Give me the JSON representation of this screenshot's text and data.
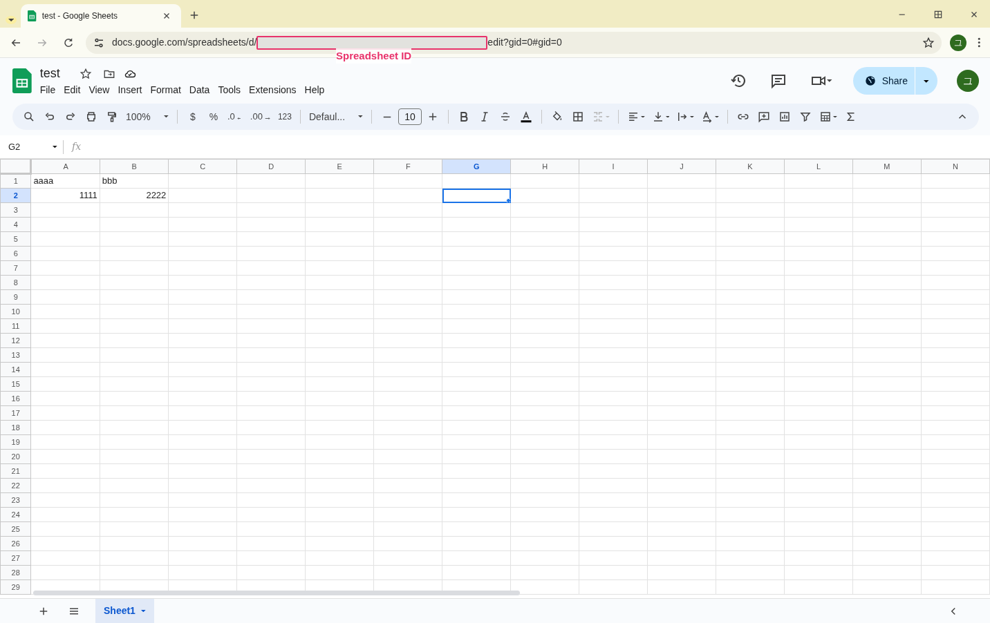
{
  "browser": {
    "tab_title": "test - Google Sheets",
    "url_prefix": "docs.google.com/spreadsheets/d/",
    "url_suffix": "edit?gid=0#gid=0",
    "annotation": "Spreadsheet ID",
    "profile_initial": "그"
  },
  "document": {
    "title": "test",
    "menus": [
      "File",
      "Edit",
      "View",
      "Insert",
      "Format",
      "Data",
      "Tools",
      "Extensions",
      "Help"
    ],
    "share": "Share",
    "avatar_initial": "그"
  },
  "toolbar": {
    "zoom": "100%",
    "currency": "$",
    "percent": "%",
    "decrease_decimal": ".0",
    "increase_decimal": ".00",
    "number_format": "123",
    "font": "Defaul...",
    "font_size": "10"
  },
  "formula_bar": {
    "name_box": "G2",
    "fx": "fx"
  },
  "columns": [
    {
      "label": "A",
      "selected": false
    },
    {
      "label": "B",
      "selected": false
    },
    {
      "label": "C",
      "selected": false
    },
    {
      "label": "D",
      "selected": false
    },
    {
      "label": "E",
      "selected": false
    },
    {
      "label": "F",
      "selected": false
    },
    {
      "label": "G",
      "selected": true
    },
    {
      "label": "H",
      "selected": false
    },
    {
      "label": "I",
      "selected": false
    },
    {
      "label": "J",
      "selected": false
    },
    {
      "label": "K",
      "selected": false
    },
    {
      "label": "L",
      "selected": false
    },
    {
      "label": "M",
      "selected": false
    },
    {
      "label": "N",
      "selected": false
    }
  ],
  "rows": [
    {
      "label": "1",
      "selected": false,
      "cells": {
        "A": {
          "kind": "text",
          "value": "aaaa"
        },
        "B": {
          "kind": "text",
          "value": "bbb"
        }
      }
    },
    {
      "label": "2",
      "selected": true,
      "cells": {
        "A": {
          "kind": "number",
          "value": "1111"
        },
        "B": {
          "kind": "number",
          "value": "2222"
        },
        "G": {
          "active": true
        }
      }
    },
    {
      "label": "3",
      "selected": false
    },
    {
      "label": "4",
      "selected": false
    },
    {
      "label": "5",
      "selected": false
    },
    {
      "label": "6",
      "selected": false
    },
    {
      "label": "7",
      "selected": false
    },
    {
      "label": "8",
      "selected": false
    },
    {
      "label": "9",
      "selected": false
    },
    {
      "label": "10",
      "selected": false
    },
    {
      "label": "11",
      "selected": false
    },
    {
      "label": "12",
      "selected": false
    },
    {
      "label": "13",
      "selected": false
    },
    {
      "label": "14",
      "selected": false
    },
    {
      "label": "15",
      "selected": false
    },
    {
      "label": "16",
      "selected": false
    },
    {
      "label": "17",
      "selected": false
    },
    {
      "label": "18",
      "selected": false
    },
    {
      "label": "19",
      "selected": false
    },
    {
      "label": "20",
      "selected": false
    },
    {
      "label": "21",
      "selected": false
    },
    {
      "label": "22",
      "selected": false
    },
    {
      "label": "23",
      "selected": false
    },
    {
      "label": "24",
      "selected": false
    },
    {
      "label": "25",
      "selected": false
    },
    {
      "label": "26",
      "selected": false
    },
    {
      "label": "27",
      "selected": false
    },
    {
      "label": "28",
      "selected": false
    },
    {
      "label": "29",
      "selected": false
    }
  ],
  "sheets": [
    {
      "name": "Sheet1",
      "selected": true
    }
  ]
}
